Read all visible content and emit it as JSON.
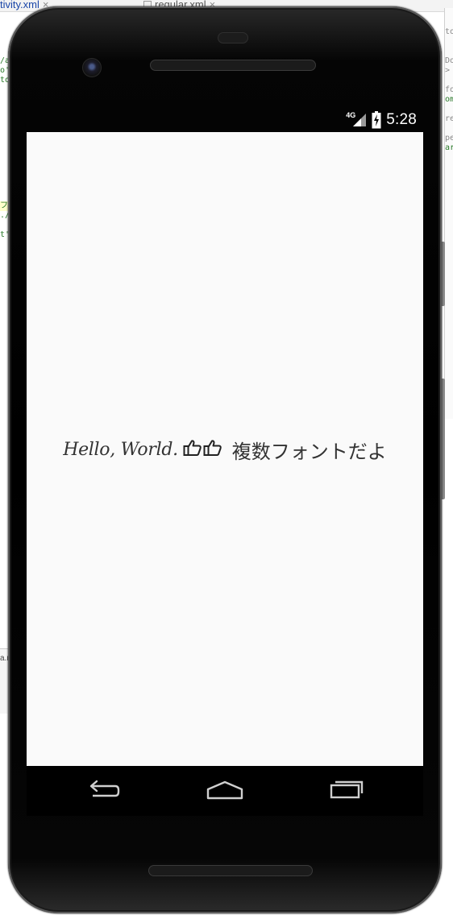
{
  "ide": {
    "left_tab_label": "tivity.xml",
    "right_tab_label": "regular.xml",
    "left_code_snippets": [
      "/a",
      "o'",
      "to",
      "",
      "",
      "",
      "",
      "",
      "",
      "",
      "",
      "",
      "",
      "",
      "",
      "フ",
      "./",
      "",
      "",
      "t'"
    ],
    "right_code_snippets": [
      "to",
      "",
      "",
      "Do",
      ">",
      "",
      "fo",
      "om",
      "",
      "re",
      "",
      "pe",
      "ar"
    ],
    "bottom_strip_text": "a.n"
  },
  "status_bar": {
    "network_type": "4G",
    "time": "5:28",
    "icons": [
      "signal-icon",
      "battery-charging-icon"
    ]
  },
  "screen": {
    "hello_text": "Hello, World.",
    "emoji_icons": [
      "thumbs-up-icon",
      "thumbs-up-icon"
    ],
    "japanese_text": "複数フォントだよ"
  },
  "nav_bar": {
    "buttons": [
      "back-icon",
      "home-icon",
      "recents-icon"
    ]
  },
  "colors": {
    "screen_background": "#fafafa",
    "text": "#333333",
    "phone_body": "#000000"
  }
}
